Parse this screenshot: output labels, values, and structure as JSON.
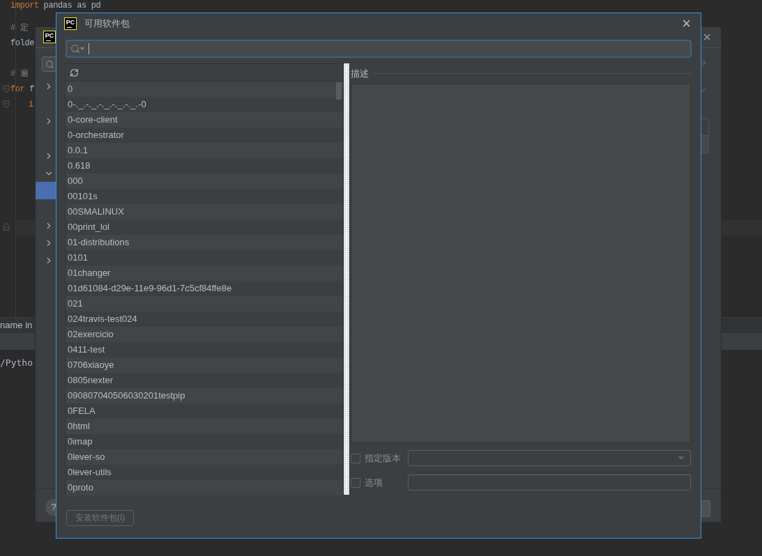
{
  "editor": {
    "code_lines": [
      {
        "kind": "code",
        "keyword": "import",
        "rest": " pandas as pd",
        "indent": false
      },
      {
        "kind": "blank"
      },
      {
        "kind": "comment",
        "rest": "# 定",
        "indent": false
      },
      {
        "kind": "code",
        "rest": "folde",
        "indent": false
      },
      {
        "kind": "blank"
      },
      {
        "kind": "comment",
        "rest": "# 遍",
        "indent": false
      },
      {
        "kind": "code",
        "keyword": "for",
        "rest": " f",
        "indent": false
      },
      {
        "kind": "code",
        "keyword": "i",
        "indent": true
      }
    ],
    "bottom_panel": {
      "header_text": "name in",
      "path_text": "/Pytho"
    }
  },
  "back_dialog": {
    "logo_text": "PC",
    "close": "×",
    "help": "?",
    "tree_rows": [
      {
        "kind": "collapsed",
        "selected": false
      },
      {
        "kind": "leaf",
        "selected": false
      },
      {
        "kind": "collapsed",
        "selected": false
      },
      {
        "kind": "leaf",
        "selected": false
      },
      {
        "kind": "collapsed",
        "selected": false
      },
      {
        "kind": "expanded",
        "selected": false
      },
      {
        "kind": "leaf",
        "selected": true
      },
      {
        "kind": "leaf",
        "selected": false
      },
      {
        "kind": "collapsed",
        "selected": false
      },
      {
        "kind": "collapsed",
        "selected": false
      },
      {
        "kind": "collapsed",
        "selected": false
      }
    ]
  },
  "dialog": {
    "logo_text": "PC",
    "title": "可用软件包",
    "close": "×",
    "packages": [
      "0",
      "0-._.-._.-._.-._.-._.-0",
      "0-core-client",
      "0-orchestrator",
      "0.0.1",
      "0.618",
      "000",
      "00101s",
      "00SMALINUX",
      "00print_lol",
      "01-distributions",
      "0101",
      "01changer",
      "01d61084-d29e-11e9-96d1-7c5cf84ffe8e",
      "021",
      "024travis-test024",
      "02exercicio",
      "0411-test",
      "0706xiaoye",
      "0805nexter",
      "090807040506030201testpip",
      "0FELA",
      "0html",
      "0imap",
      "0lever-so",
      "0lever-utils",
      "0proto"
    ],
    "description_label": "描述",
    "options": [
      {
        "kind": "dropdown",
        "label": "指定版本",
        "checked": false
      },
      {
        "kind": "text",
        "label": "选项",
        "checked": false
      }
    ],
    "install_button": {
      "label": "安装软件包(I)",
      "disabled": true
    }
  }
}
